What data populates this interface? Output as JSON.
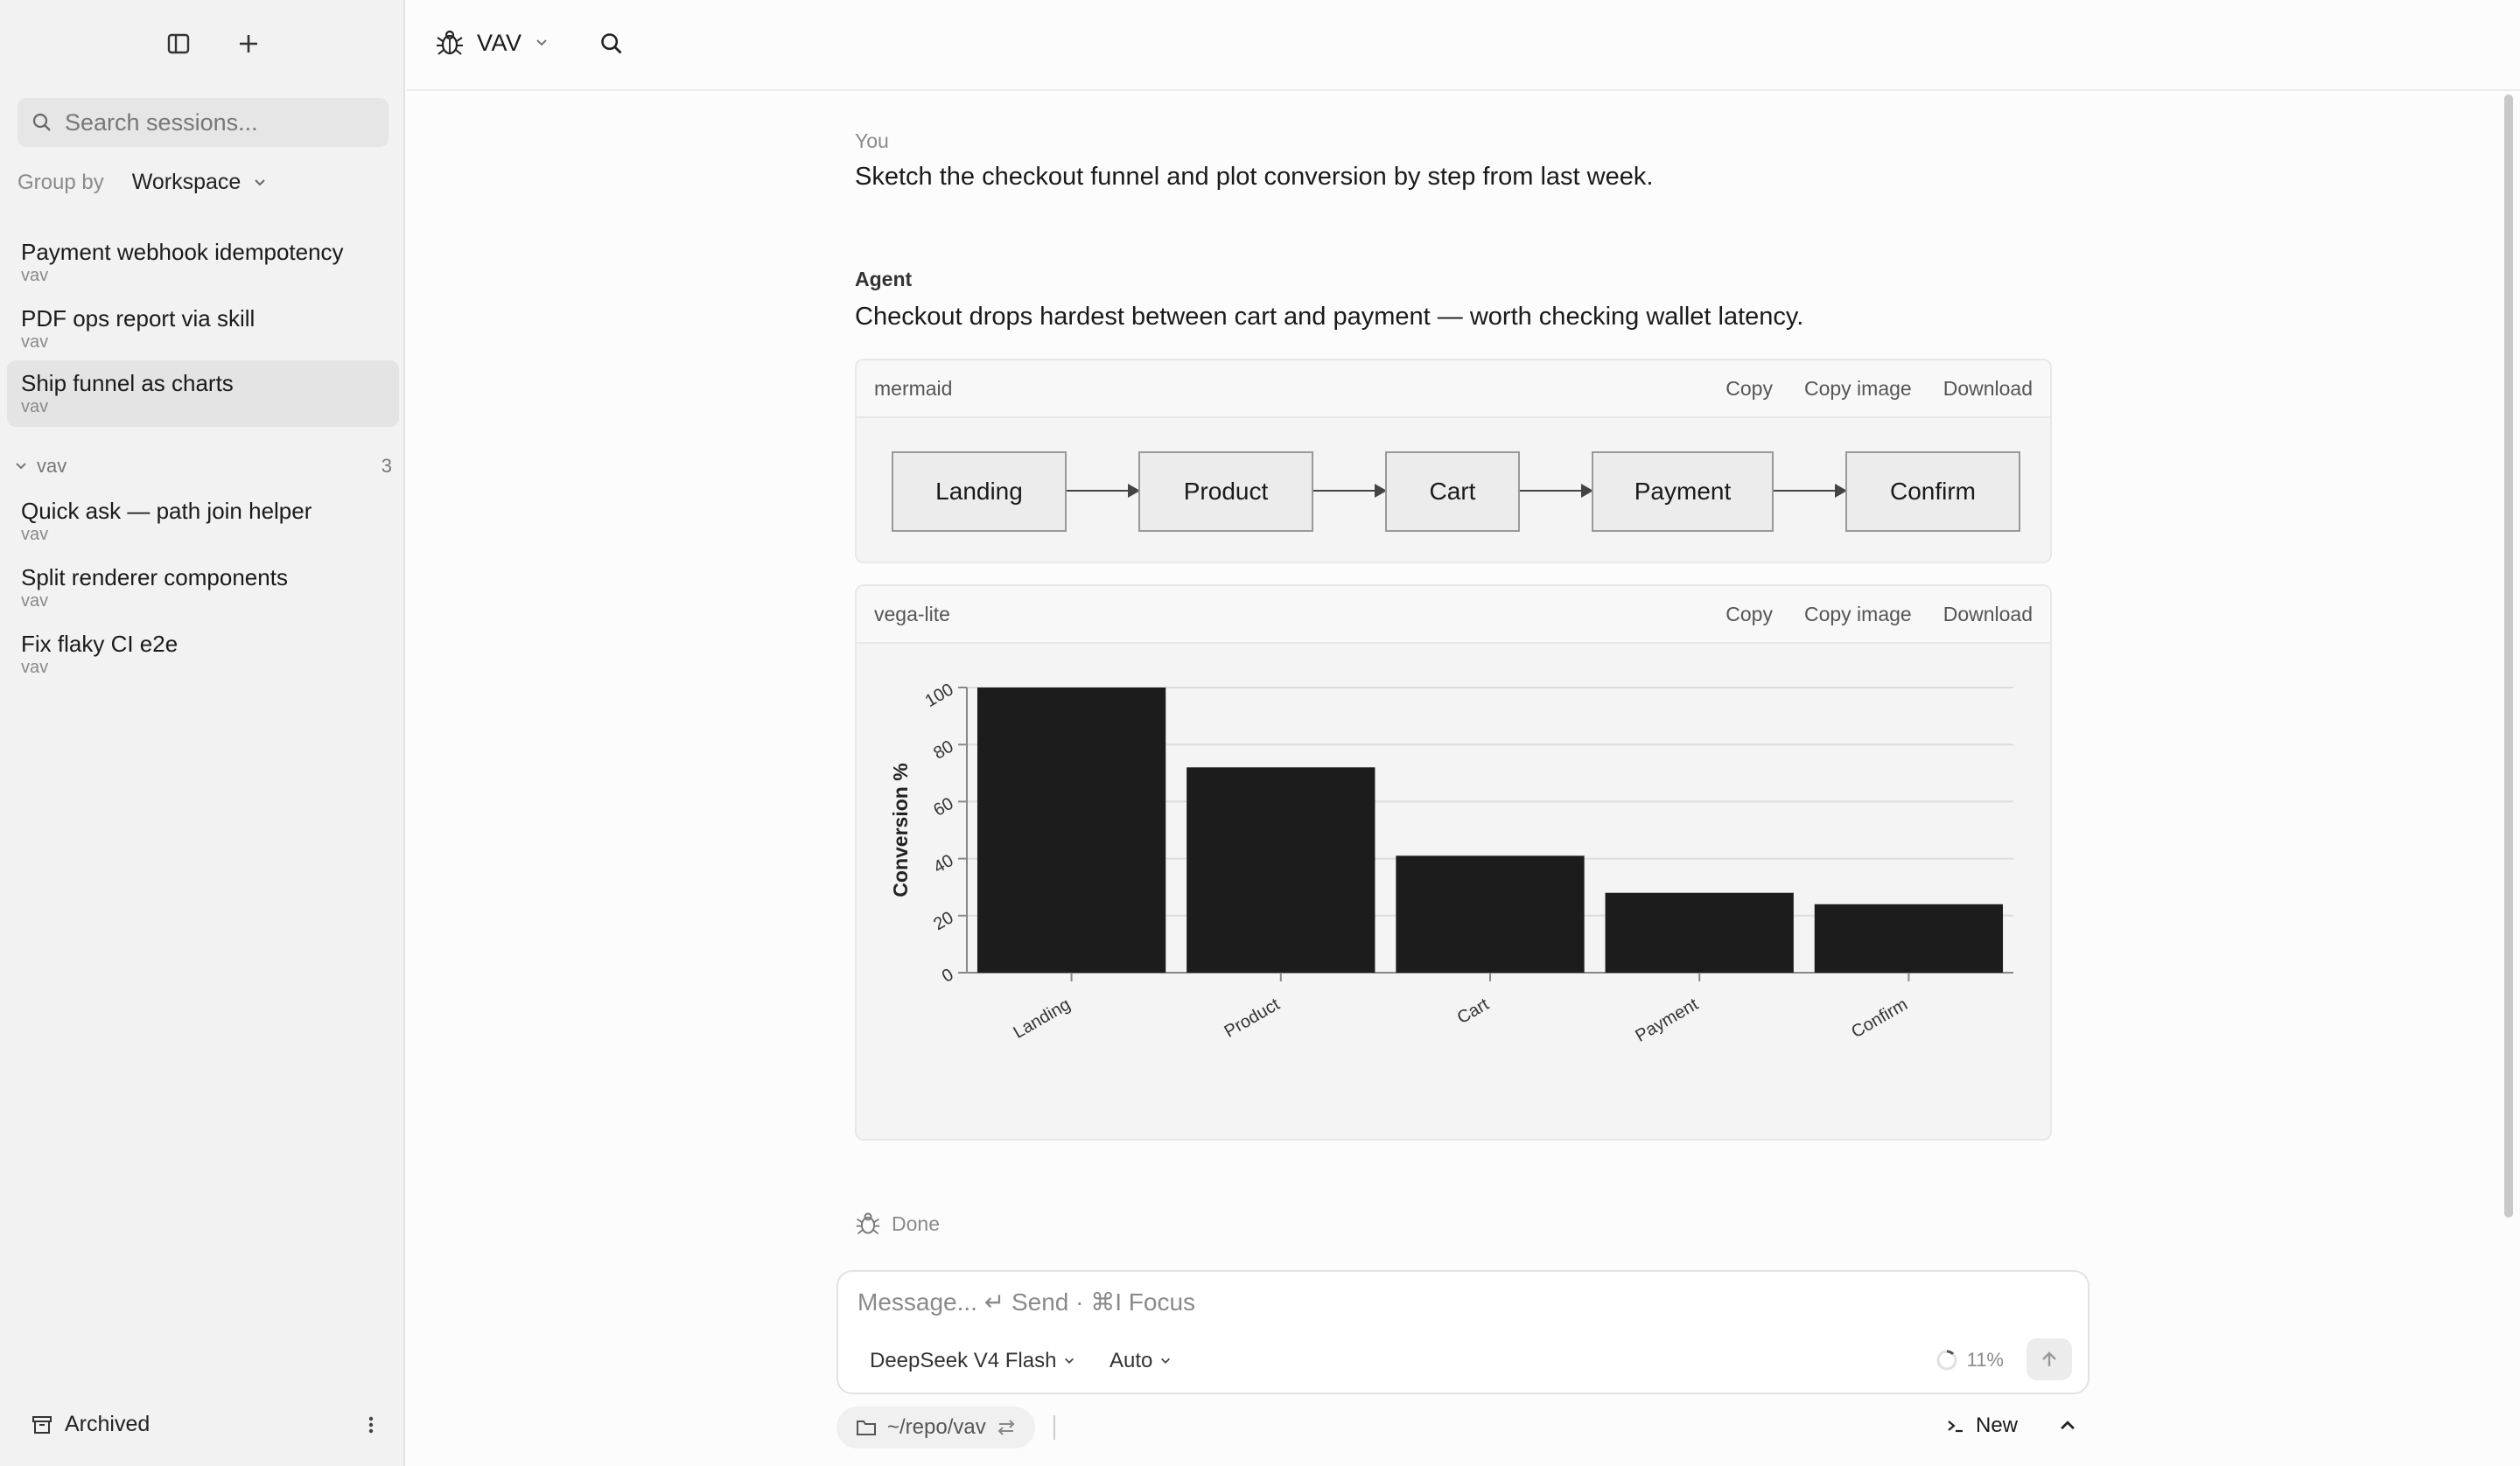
{
  "sidebar": {
    "search_placeholder": "Search sessions...",
    "groupby_label": "Group by",
    "groupby_value": "Workspace",
    "sessions_top": [
      {
        "title": "Payment webhook idempotency",
        "sub": "vav"
      },
      {
        "title": "PDF ops report via skill",
        "sub": "vav"
      },
      {
        "title": "Ship funnel as charts",
        "sub": "vav"
      }
    ],
    "group": {
      "name": "vav",
      "count": "3"
    },
    "sessions_group": [
      {
        "title": "Quick ask — path join helper",
        "sub": "vav"
      },
      {
        "title": "Split renderer components",
        "sub": "vav"
      },
      {
        "title": "Fix flaky CI e2e",
        "sub": "vav"
      }
    ],
    "archived_label": "Archived"
  },
  "topbar": {
    "workspace": "VAV"
  },
  "conversation": {
    "you_label": "You",
    "you_text": "Sketch the checkout funnel and plot conversion by step from last week.",
    "agent_label": "Agent",
    "agent_text": "Checkout drops hardest between cart and payment — worth checking wallet latency.",
    "done_label": "Done"
  },
  "mermaid_block": {
    "lang": "mermaid",
    "copy": "Copy",
    "copy_image": "Copy image",
    "download": "Download",
    "nodes": [
      "Landing",
      "Product",
      "Cart",
      "Payment",
      "Confirm"
    ]
  },
  "vega_block": {
    "lang": "vega-lite",
    "copy": "Copy",
    "copy_image": "Copy image",
    "download": "Download"
  },
  "chart_data": {
    "type": "bar",
    "categories": [
      "Landing",
      "Product",
      "Cart",
      "Payment",
      "Confirm"
    ],
    "values": [
      100,
      72,
      41,
      28,
      24
    ],
    "title": "",
    "xlabel": "",
    "ylabel": "Conversion %",
    "ylim": [
      0,
      100
    ],
    "yticks": [
      0,
      20,
      40,
      60,
      80,
      100
    ],
    "grid": true,
    "bar_color": "#1c1c1c"
  },
  "composer": {
    "placeholder": "Message... ↵ Send · ⌘I Focus",
    "model": "DeepSeek V4 Flash",
    "mode": "Auto",
    "context_pct": "11%"
  },
  "footer": {
    "path": "~/repo/vav",
    "new_label": "New"
  }
}
